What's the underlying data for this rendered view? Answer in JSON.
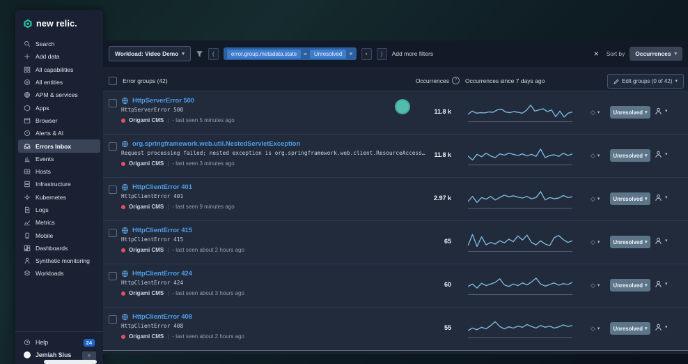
{
  "brand": {
    "name": "new relic."
  },
  "icons": {
    "chevron_down": "▾",
    "close": "×",
    "diamond": "◇",
    "collapse": "»",
    "paren_open": "(",
    "paren_close": ")",
    "dot_button": "•",
    "info": "?",
    "equals": "="
  },
  "colors": {
    "accent_teal": "#54bcae",
    "link_blue": "#4f9de8",
    "status_red": "#e44f63",
    "sparkline": "#7cb7dc",
    "spark_baseline": "#566176",
    "unresolved_bg": "#5d7589",
    "pill_bg": "#2b5f9e",
    "chip_bg": "#3e7ccd",
    "help_badge_bg": "#1f66c9"
  },
  "sidebar": {
    "items": [
      {
        "label": "Search"
      },
      {
        "label": "Add data"
      },
      {
        "label": "All capabilities"
      },
      {
        "label": "All entities"
      },
      {
        "label": "APM & services"
      },
      {
        "label": "Apps"
      },
      {
        "label": "Browser"
      },
      {
        "label": "Alerts & AI"
      },
      {
        "label": "Errors Inbox"
      },
      {
        "label": "Events"
      },
      {
        "label": "Hosts"
      },
      {
        "label": "Infrastructure"
      },
      {
        "label": "Kubernetes"
      },
      {
        "label": "Logs"
      },
      {
        "label": "Metrics"
      },
      {
        "label": "Mobile"
      },
      {
        "label": "Dashboards"
      },
      {
        "label": "Synthetic monitoring"
      },
      {
        "label": "Workloads"
      }
    ],
    "help_label": "Help",
    "help_badge": "24",
    "user_name": "Jemiah Sius"
  },
  "filter_bar": {
    "workload_label": "Workload: Video Demo",
    "pill_field": "error.group.metadata.state",
    "pill_operator": "=",
    "pill_value": "Unresolved",
    "add_more": "Add more filters",
    "sort_by_label": "Sort by",
    "sort_value": "Occurrences"
  },
  "table": {
    "meta_separator": "|",
    "header": {
      "title": "Error groups (42)",
      "occurrences_label": "Occurrences",
      "since_label": "Occurrences since 7 days ago",
      "edit_label": "Edit groups (0 of 42)"
    },
    "rows": [
      {
        "title": "HttpServerError 500",
        "subtitle": "HttpServerError 500",
        "service": "Origami CMS",
        "last_seen": "- last seen 5 minutes ago",
        "occurrences": "11.8 k",
        "status": "Unresolved",
        "spark": [
          0.35,
          0.55,
          0.42,
          0.45,
          0.44,
          0.5,
          0.48,
          0.62,
          0.68,
          0.5,
          0.45,
          0.52,
          0.48,
          0.42,
          0.6,
          0.92,
          0.55,
          0.62,
          0.7,
          0.52,
          0.62,
          0.2,
          0.55,
          0.18,
          0.42,
          0.5
        ]
      },
      {
        "title": "org.springframework.web.util.NestedServletException",
        "subtitle": "Request processing failed; nested exception is org.springframework.web.client.ResourceAccess…",
        "service": "Origami CMS",
        "last_seen": "- last seen 3 minutes ago",
        "occurrences": "11.8 k",
        "status": "Unresolved",
        "spark": [
          0.45,
          0.2,
          0.55,
          0.4,
          0.62,
          0.45,
          0.35,
          0.58,
          0.5,
          0.62,
          0.55,
          0.48,
          0.58,
          0.45,
          0.55,
          0.42,
          0.88,
          0.35,
          0.48,
          0.52,
          0.42,
          0.62,
          0.48,
          0.58
        ]
      },
      {
        "title": "HttpClientError 401",
        "subtitle": "HttpClientError 401",
        "service": "Origami CMS",
        "last_seen": "- last seen 9 minutes ago",
        "occurrences": "2.97 k",
        "status": "Unresolved",
        "spark": [
          0.3,
          0.62,
          0.25,
          0.55,
          0.45,
          0.62,
          0.4,
          0.55,
          0.7,
          0.6,
          0.66,
          0.58,
          0.52,
          0.62,
          0.48,
          0.55,
          0.92,
          0.4,
          0.55,
          0.48,
          0.52,
          0.68,
          0.55,
          0.6
        ]
      },
      {
        "title": "HttpClientError 415",
        "subtitle": "HttpClientError 415",
        "service": "Origami CMS",
        "last_seen": "- last seen about 2 hours ago",
        "occurrences": "65",
        "status": "Unresolved",
        "spark": [
          0.25,
          0.95,
          0.2,
          0.8,
          0.3,
          0.45,
          0.35,
          0.55,
          0.42,
          0.65,
          0.5,
          0.85,
          0.6,
          0.9,
          0.45,
          0.3,
          0.55,
          0.35,
          0.25,
          0.75,
          0.88,
          0.62,
          0.45,
          0.55
        ]
      },
      {
        "title": "HttpClientError 424",
        "subtitle": "HttpClientError 424",
        "service": "Origami CMS",
        "last_seen": "- last seen about 3 hours ago",
        "occurrences": "60",
        "status": "Unresolved",
        "spark": [
          0.4,
          0.55,
          0.3,
          0.6,
          0.45,
          0.55,
          0.65,
          0.88,
          0.5,
          0.4,
          0.55,
          0.45,
          0.62,
          0.5,
          0.68,
          0.92,
          0.55,
          0.42,
          0.52,
          0.62,
          0.48,
          0.58,
          0.52,
          0.65
        ]
      },
      {
        "title": "HttpClientError 408",
        "subtitle": "HttpClientError 408",
        "service": "Origami CMS",
        "last_seen": "- last seen about 2 hours ago",
        "occurrences": "55",
        "status": "Unresolved",
        "spark": [
          0.35,
          0.5,
          0.4,
          0.55,
          0.45,
          0.65,
          0.9,
          0.6,
          0.45,
          0.58,
          0.5,
          0.62,
          0.55,
          0.72,
          0.6,
          0.5,
          0.66,
          0.55,
          0.62,
          0.5,
          0.58,
          0.7,
          0.6,
          0.66
        ]
      }
    ]
  }
}
